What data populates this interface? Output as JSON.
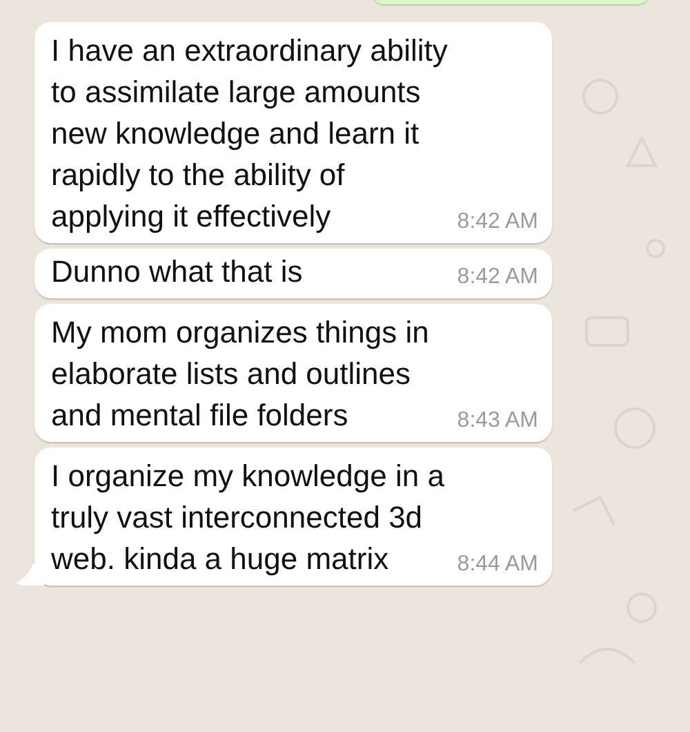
{
  "messages": [
    {
      "lines": [
        "I have an extraordinary ability",
        "to assimilate large amounts",
        "new knowledge and learn it",
        "rapidly to the ability of",
        "applying it effectively"
      ],
      "time": "8:42 AM",
      "tail": false
    },
    {
      "lines": [
        "Dunno what that is"
      ],
      "time": "8:42 AM",
      "tail": false
    },
    {
      "lines": [
        "My mom organizes things in",
        "elaborate lists and outlines",
        "and mental file folders"
      ],
      "time": "8:43 AM",
      "tail": false
    },
    {
      "lines": [
        "I organize my knowledge in a",
        "truly vast interconnected 3d",
        "web. kinda a huge matrix"
      ],
      "time": "8:44 AM",
      "tail": true
    }
  ]
}
